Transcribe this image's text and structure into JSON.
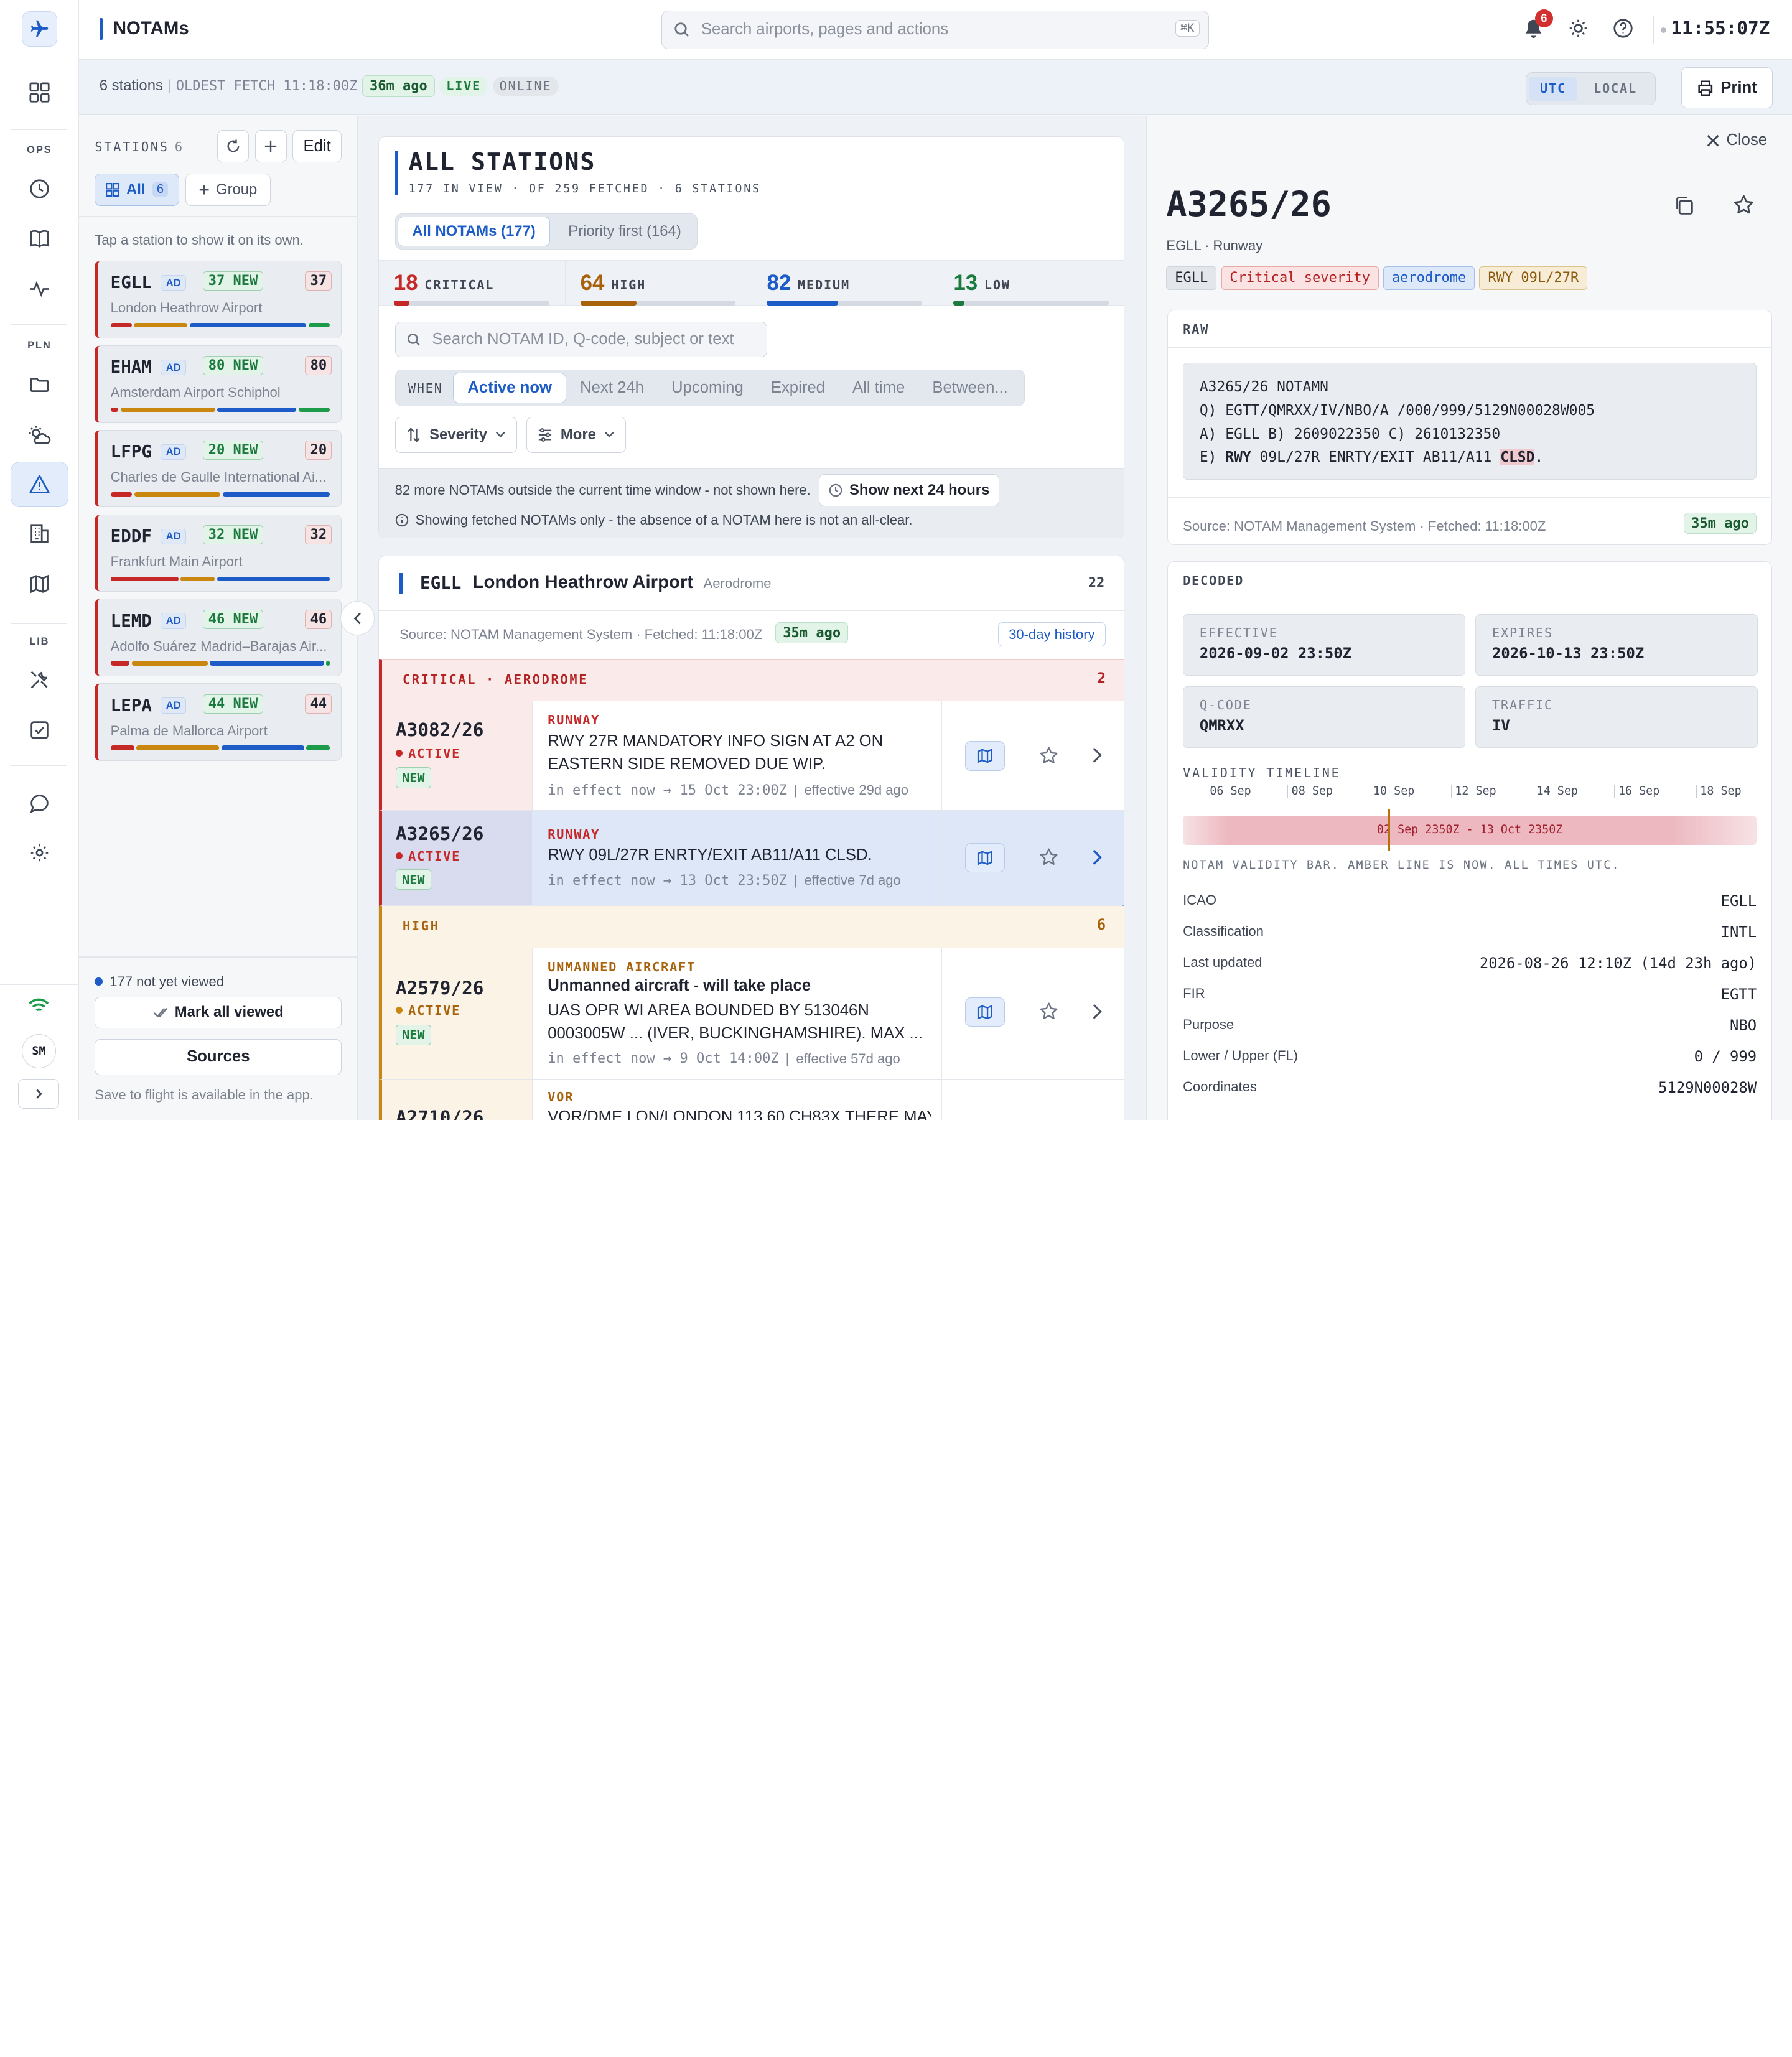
{
  "rail": {
    "sections": [
      "OPS",
      "PLN",
      "LIB"
    ],
    "avatar": "SM"
  },
  "topbar": {
    "title": "NOTAMs",
    "search_placeholder": "Search airports, pages and actions",
    "search_shortcut": "⌘K",
    "notif_count": "6",
    "clock": "11:55:07Z"
  },
  "subbar": {
    "stations": "6 stations",
    "oldest_fetch": "OLDEST FETCH 11:18:00Z",
    "fetch_age": "36m ago",
    "live": "LIVE",
    "online": "ONLINE",
    "utc": "UTC",
    "local": "LOCAL",
    "print": "Print"
  },
  "stations": {
    "header": "STATIONS",
    "count": "6",
    "edit": "Edit",
    "all": "All",
    "all_count": "6",
    "group": "Group",
    "hint": "Tap a station to show it on its own.",
    "items": [
      {
        "code": "EGLL",
        "ad": "AD",
        "new": "37 NEW",
        "count": "37",
        "name": "London Heathrow Airport",
        "bar": [
          2,
          5,
          11,
          2
        ]
      },
      {
        "code": "EHAM",
        "ad": "AD",
        "new": "80 NEW",
        "count": "80",
        "name": "Amsterdam Airport Schiphol",
        "bar": [
          1,
          12,
          10,
          4
        ]
      },
      {
        "code": "LFPG",
        "ad": "AD",
        "new": "20 NEW",
        "count": "20",
        "name": "Charles de Gaulle International Ai...",
        "bar": [
          2,
          8,
          10,
          0
        ]
      },
      {
        "code": "EDDF",
        "ad": "AD",
        "new": "32 NEW",
        "count": "32",
        "name": "Frankfurt Main Airport",
        "bar": [
          6,
          3,
          10,
          0
        ]
      },
      {
        "code": "LEMD",
        "ad": "AD",
        "new": "46 NEW",
        "count": "46",
        "name": "Adolfo Suárez Madrid–Barajas Air...",
        "bar": [
          2,
          8,
          12,
          0.4
        ]
      },
      {
        "code": "LEPA",
        "ad": "AD",
        "new": "44 NEW",
        "count": "44",
        "name": "Palma de Mallorca Airport",
        "bar": [
          2,
          7,
          7,
          2
        ]
      }
    ],
    "not_viewed": "177 not yet viewed",
    "mark_all": "Mark all viewed",
    "sources": "Sources",
    "footer": "Save to flight is available in the app."
  },
  "center": {
    "title": "ALL STATIONS",
    "subtitle": "177 IN VIEW · OF 259 FETCHED · 6 STATIONS",
    "tab_all": "All NOTAMs (177)",
    "tab_priority": "Priority first (164)",
    "stats": [
      {
        "n": "18",
        "label": "CRITICAL",
        "color": "#c62828",
        "fill": 0.1
      },
      {
        "n": "64",
        "label": "HIGH",
        "color": "#a8620c",
        "fill": 0.36
      },
      {
        "n": "82",
        "label": "MEDIUM",
        "color": "#1d5bc6",
        "fill": 0.46
      },
      {
        "n": "13",
        "label": "LOW",
        "color": "#1c7a3e",
        "fill": 0.07
      }
    ],
    "search_placeholder": "Search NOTAM ID, Q-code, subject or text",
    "when": "WHEN",
    "when_options": [
      "Active now",
      "Next 24h",
      "Upcoming",
      "Expired",
      "All time",
      "Between..."
    ],
    "sort": "Severity",
    "more": "More",
    "outside": "82 more NOTAMs outside the current time window - not shown here.",
    "show_next": "Show next 24 hours",
    "disclaimer": "Showing fetched NOTAMs only - the absence of a NOTAM here is not an all-clear.",
    "airport": {
      "code": "EGLL",
      "name": "London Heathrow Airport",
      "type": "Aerodrome",
      "count": "22",
      "source": "Source: NOTAM Management System · Fetched: 11:18:00Z",
      "age": "35m ago",
      "history": "30-day history"
    },
    "group_critical": "CRITICAL · AERODROME",
    "group_critical_count": "2",
    "group_high": "HIGH",
    "group_high_count": "6",
    "notams": [
      {
        "id": "A3082/26",
        "status": "ACTIVE",
        "new": "NEW",
        "cat": "RUNWAY",
        "text": "RWY 27R MANDATORY INFO SIGN AT A2 ON EASTERN SIDE REMOVED DUE WIP.",
        "window": "in effect now → 15 Oct 23:00Z",
        "eff": "effective 29d ago"
      },
      {
        "id": "A3265/26",
        "status": "ACTIVE",
        "new": "NEW",
        "cat": "RUNWAY",
        "text": "RWY 09L/27R ENRTY/EXIT AB11/A11 CLSD.",
        "window": "in effect now → 13 Oct 23:50Z",
        "eff": "effective 7d ago"
      },
      {
        "id": "A2579/26",
        "status": "ACTIVE",
        "new": "NEW",
        "cat": "UNMANNED AIRCRAFT",
        "title": "Unmanned aircraft - will take place",
        "text": "UAS OPR WI AREA BOUNDED BY 513046N 0003005W ... (IVER, BUCKINGHAMSHIRE). MAX ...",
        "window": "in effect now → 9 Oct 14:00Z",
        "eff": "effective 57d ago"
      },
      {
        "id": "A2710/26",
        "cat": "VOR",
        "text": "VOR/DME LON/LONDON 113.60 CH83X THERE MAY"
      }
    ]
  },
  "detail": {
    "close": "Close",
    "id": "A3265/26",
    "sub": "EGLL · Runway",
    "tags": [
      "EGLL",
      "Critical severity",
      "aerodrome",
      "RWY 09L/27R"
    ],
    "raw_header": "RAW",
    "raw": {
      "l1": "A3265/26 NOTAMN",
      "l2": "Q) EGTT/QMRXX/IV/NBO/A /000/999/5129N00028W005",
      "l3": "A) EGLL B) 2609022350 C) 2610132350",
      "e_prefix": "E) ",
      "e_rwy": "RWY",
      "e_mid": " 09L/27R ENRTY/EXIT AB11/A11 ",
      "e_clsd": "CLSD",
      "e_end": "."
    },
    "source": "Source: NOTAM Management System · Fetched: 11:18:00Z",
    "age": "35m ago",
    "decoded_header": "DECODED",
    "boxes": [
      {
        "label": "EFFECTIVE",
        "value": "2026-09-02 23:50Z"
      },
      {
        "label": "EXPIRES",
        "value": "2026-10-13 23:50Z"
      },
      {
        "label": "Q-CODE",
        "value": "QMRXX"
      },
      {
        "label": "TRAFFIC",
        "value": "IV"
      }
    ],
    "timeline_label": "VALIDITY TIMELINE",
    "timeline_ticks": [
      "06 Sep",
      "08 Sep",
      "10 Sep",
      "12 Sep",
      "14 Sep",
      "16 Sep",
      "18 Sep"
    ],
    "timeline_bar": "02 Sep 2350Z - 13 Oct 2350Z",
    "timeline_note": "NOTAM VALIDITY BAR. AMBER LINE IS NOW. ALL TIMES UTC.",
    "fields": [
      {
        "k": "ICAO",
        "v": "EGLL"
      },
      {
        "k": "Classification",
        "v": "INTL"
      },
      {
        "k": "Last updated",
        "v": "2026-08-26 12:10Z (14d 23h ago)"
      },
      {
        "k": "FIR",
        "v": "EGTT"
      },
      {
        "k": "Purpose",
        "v": "NBO"
      },
      {
        "k": "Lower / Upper (FL)",
        "v": "0 / 999"
      },
      {
        "k": "Coordinates",
        "v": "5129N00028W"
      }
    ]
  }
}
